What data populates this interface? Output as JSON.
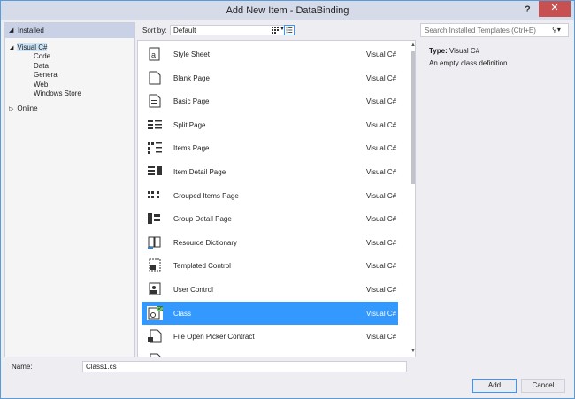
{
  "window": {
    "title": "Add New Item - DataBinding",
    "help_label": "?",
    "close_label": "✕"
  },
  "tree": {
    "header": "Installed",
    "nodes": [
      {
        "label": "Visual C#",
        "level": 0,
        "expanded": true,
        "selected": true
      },
      {
        "label": "Code",
        "level": 1
      },
      {
        "label": "Data",
        "level": 1
      },
      {
        "label": "General",
        "level": 1
      },
      {
        "label": "Web",
        "level": 1
      },
      {
        "label": "Windows Store",
        "level": 1
      },
      {
        "label": "Online",
        "level": 0,
        "expanded": false
      }
    ]
  },
  "sort": {
    "label": "Sort by:",
    "value": "Default"
  },
  "templates": [
    {
      "name": "Style Sheet",
      "lang": "Visual C#",
      "icon": "style-sheet-icon"
    },
    {
      "name": "Blank Page",
      "lang": "Visual C#",
      "icon": "blank-page-icon"
    },
    {
      "name": "Basic Page",
      "lang": "Visual C#",
      "icon": "basic-page-icon"
    },
    {
      "name": "Split Page",
      "lang": "Visual C#",
      "icon": "split-page-icon"
    },
    {
      "name": "Items Page",
      "lang": "Visual C#",
      "icon": "items-page-icon"
    },
    {
      "name": "Item Detail Page",
      "lang": "Visual C#",
      "icon": "item-detail-page-icon"
    },
    {
      "name": "Grouped Items Page",
      "lang": "Visual C#",
      "icon": "grouped-items-page-icon"
    },
    {
      "name": "Group Detail Page",
      "lang": "Visual C#",
      "icon": "group-detail-page-icon"
    },
    {
      "name": "Resource Dictionary",
      "lang": "Visual C#",
      "icon": "resource-dictionary-icon"
    },
    {
      "name": "Templated Control",
      "lang": "Visual C#",
      "icon": "templated-control-icon"
    },
    {
      "name": "User Control",
      "lang": "Visual C#",
      "icon": "user-control-icon"
    },
    {
      "name": "Class",
      "lang": "Visual C#",
      "icon": "class-icon",
      "selected": true
    },
    {
      "name": "File Open Picker Contract",
      "lang": "Visual C#",
      "icon": "file-open-picker-icon"
    },
    {
      "name": "",
      "lang": "",
      "icon": "partial-item-icon"
    }
  ],
  "search": {
    "placeholder": "Search Installed Templates (Ctrl+E)"
  },
  "details": {
    "type_key": "Type:",
    "type_value": "Visual C#",
    "description": "An empty class definition"
  },
  "name_field": {
    "label": "Name:",
    "value": "Class1.cs"
  },
  "buttons": {
    "add": "Add",
    "cancel": "Cancel"
  },
  "colors": {
    "accent": "#3399ff",
    "title_bg": "#d6dbe9",
    "close_bg": "#c75050"
  }
}
